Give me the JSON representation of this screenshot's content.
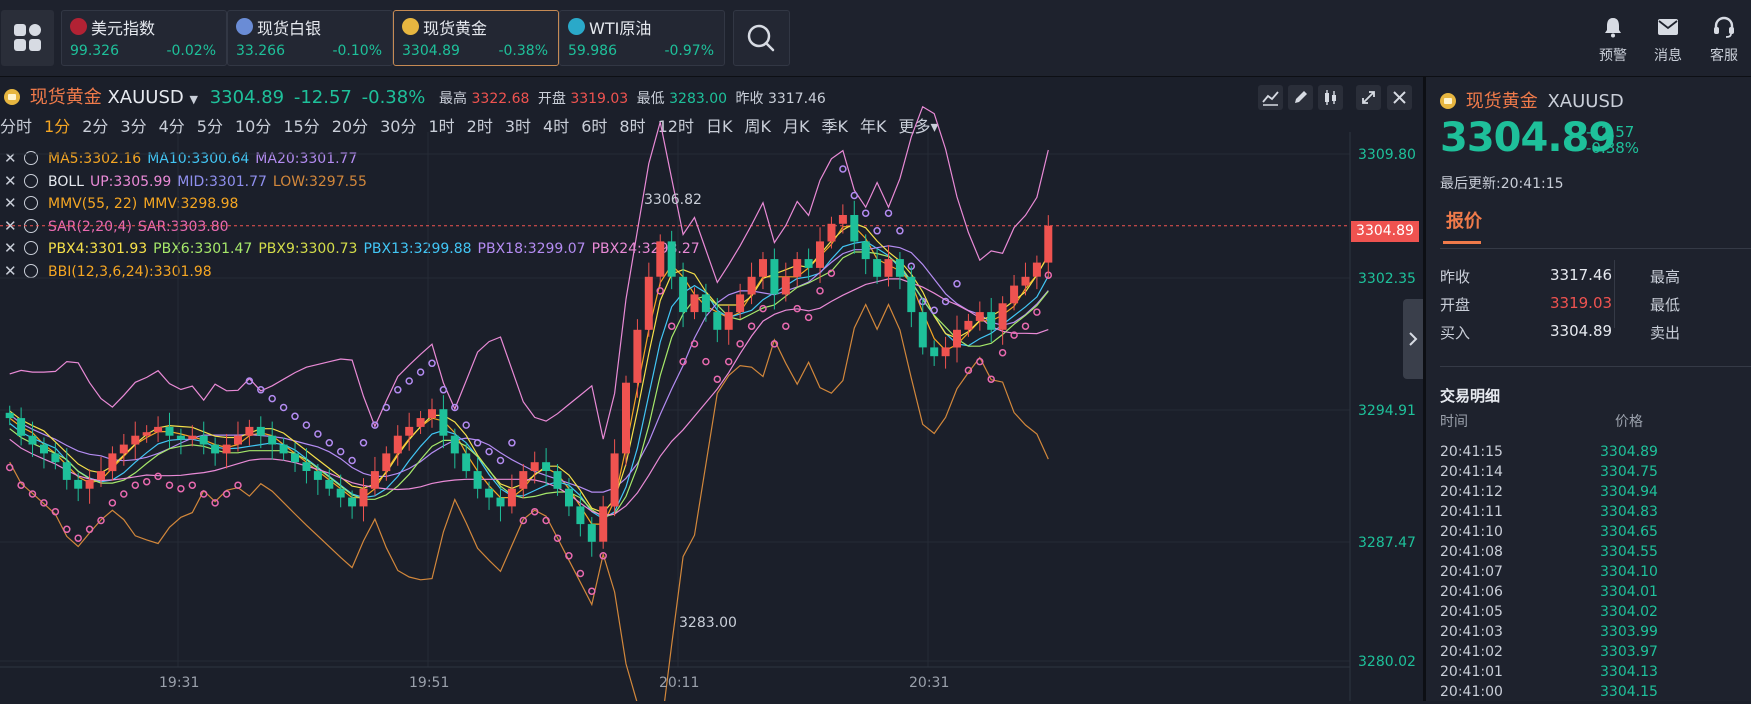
{
  "topbar": {
    "tickers": [
      {
        "name": "美元指数",
        "price": "99.326",
        "change": "-0.02%",
        "flag": "us-flag-icon",
        "color": "#b22234"
      },
      {
        "name": "现货白银",
        "price": "33.266",
        "change": "-0.10%",
        "flag": "silver-coin-icon",
        "color": "#6a8cd6"
      },
      {
        "name": "现货黄金",
        "price": "3304.89",
        "change": "-0.38%",
        "flag": "gold-coin-icon",
        "color": "#e7b640"
      },
      {
        "name": "WTI原油",
        "price": "59.986",
        "change": "-0.97%",
        "flag": "oil-icon",
        "color": "#2aa9c9"
      }
    ],
    "right": {
      "alert": "预警",
      "message": "消息",
      "service": "客服"
    }
  },
  "chart": {
    "symbol_cn": "现货黄金",
    "symbol": "XAUUSD",
    "price": "3304.89",
    "change": "-12.57",
    "change_pct": "-0.38%",
    "high_label": "最高",
    "high": "3322.68",
    "open_label": "开盘",
    "open": "3319.03",
    "low_label": "最低",
    "low": "3283.00",
    "prev_label": "昨收",
    "prev": "3317.46",
    "timeframes": [
      "分时",
      "1分",
      "2分",
      "3分",
      "4分",
      "5分",
      "10分",
      "15分",
      "20分",
      "30分",
      "1时",
      "2时",
      "3时",
      "4时",
      "6时",
      "8时",
      "12时",
      "日K",
      "周K",
      "月K",
      "季K",
      "年K",
      "更多▾"
    ],
    "active_timeframe": "1分",
    "indicators": [
      [
        {
          "t": "MA5:3302.16",
          "c": "#f5a623"
        },
        {
          "t": "MA10:3300.64",
          "c": "#42c6f5"
        },
        {
          "t": "MA20:3301.77",
          "c": "#b48cf2"
        }
      ],
      [
        {
          "t": "BOLL",
          "c": "#e6e9ef"
        },
        {
          "t": "UP:3305.99",
          "c": "#e98ad6"
        },
        {
          "t": "MID:3301.77",
          "c": "#8f8fee"
        },
        {
          "t": "LOW:3297.55",
          "c": "#d2873b"
        }
      ],
      [
        {
          "t": "MMV(55, 22)",
          "c": "#f5a623"
        },
        {
          "t": "MMV:3298.98",
          "c": "#f5a623"
        }
      ],
      [
        {
          "t": "SAR(2,20,4)",
          "c": "#e96ab0"
        },
        {
          "t": "SAR:3303.80",
          "c": "#e96ab0"
        }
      ],
      [
        {
          "t": "PBX4:3301.93",
          "c": "#f5e04a"
        },
        {
          "t": "PBX6:3301.47",
          "c": "#a6e86a"
        },
        {
          "t": "PBX9:3300.73",
          "c": "#d4dd4a"
        },
        {
          "t": "PBX13:3299.88",
          "c": "#42c6f5"
        },
        {
          "t": "PBX18:3299.07",
          "c": "#b48cf2"
        },
        {
          "t": "PBX24:3298.27",
          "c": "#e98ad6"
        }
      ],
      [
        {
          "t": "BBI(12,3,6,24):3301.98",
          "c": "#f5a623"
        }
      ]
    ],
    "y_axis": [
      "3309.80",
      "3302.35",
      "3294.91",
      "3287.47",
      "3280.02"
    ],
    "x_axis": [
      "19:31",
      "19:51",
      "20:11",
      "20:31"
    ],
    "current_price_tag": "3304.89",
    "high_marker": "3306.82",
    "low_marker": "3283.00"
  },
  "chart_data": {
    "type": "candlestick",
    "ylim": [
      3280.02,
      3309.8
    ],
    "x_ticks": [
      "19:31",
      "19:51",
      "20:11",
      "20:31"
    ],
    "close_series": [
      3294,
      3293,
      3292.5,
      3292,
      3291.5,
      3290.5,
      3290,
      3290.5,
      3291,
      3292,
      3292.5,
      3293,
      3293.2,
      3293.5,
      3293,
      3292.8,
      3293,
      3292.5,
      3292,
      3292.5,
      3293,
      3293.5,
      3293,
      3292.5,
      3292,
      3291.5,
      3291,
      3290.5,
      3290,
      3289.5,
      3289,
      3290,
      3291,
      3292,
      3293,
      3293.5,
      3294,
      3294.5,
      3293,
      3292,
      3291,
      3290,
      3289.5,
      3289,
      3290,
      3291,
      3291.5,
      3291,
      3290,
      3289,
      3288,
      3287,
      3289,
      3292,
      3296,
      3299,
      3302,
      3304,
      3302,
      3300,
      3301,
      3300,
      3299,
      3300,
      3301,
      3302,
      3303,
      3301,
      3302,
      3303,
      3302.5,
      3304,
      3305,
      3305.5,
      3304,
      3303,
      3302,
      3303,
      3302,
      3300,
      3298,
      3297.5,
      3298,
      3299,
      3299.5,
      3300,
      3299,
      3300.5,
      3301.5,
      3302,
      3302.8,
      3304.89
    ],
    "series": [
      {
        "name": "MA5",
        "value": 3302.16
      },
      {
        "name": "MA10",
        "value": 3300.64
      },
      {
        "name": "MA20",
        "value": 3301.77
      },
      {
        "name": "BOLL UP",
        "value": 3305.99
      },
      {
        "name": "BOLL MID",
        "value": 3301.77
      },
      {
        "name": "BOLL LOW",
        "value": 3297.55
      }
    ]
  },
  "sidebar": {
    "symbol_cn": "现货黄金",
    "symbol": "XAUUSD",
    "price": "3304.89",
    "change": "-12.57",
    "change_pct": "-0.38%",
    "updated": "最后更新:20:41:15",
    "tab": "报价",
    "quote_rows": [
      {
        "k": "昨收",
        "v": "3317.46",
        "vc": "#e6e9ef",
        "k2": "最高"
      },
      {
        "k": "开盘",
        "v": "3319.03",
        "vc": "#ef5350",
        "k2": "最低"
      },
      {
        "k": "买入",
        "v": "3304.89",
        "vc": "#e6e9ef",
        "k2": "卖出"
      }
    ],
    "trades_title": "交易明细",
    "trades_head": {
      "time": "时间",
      "price": "价格"
    },
    "trades": [
      {
        "time": "20:41:15",
        "price": "3304.89"
      },
      {
        "time": "20:41:14",
        "price": "3304.75"
      },
      {
        "time": "20:41:12",
        "price": "3304.94"
      },
      {
        "time": "20:41:11",
        "price": "3304.83"
      },
      {
        "time": "20:41:10",
        "price": "3304.65"
      },
      {
        "time": "20:41:08",
        "price": "3304.55"
      },
      {
        "time": "20:41:07",
        "price": "3304.10"
      },
      {
        "time": "20:41:06",
        "price": "3304.01"
      },
      {
        "time": "20:41:05",
        "price": "3304.02"
      },
      {
        "time": "20:41:03",
        "price": "3303.99"
      },
      {
        "time": "20:41:02",
        "price": "3303.97"
      },
      {
        "time": "20:41:01",
        "price": "3304.13"
      },
      {
        "time": "20:41:00",
        "price": "3304.15"
      }
    ]
  }
}
